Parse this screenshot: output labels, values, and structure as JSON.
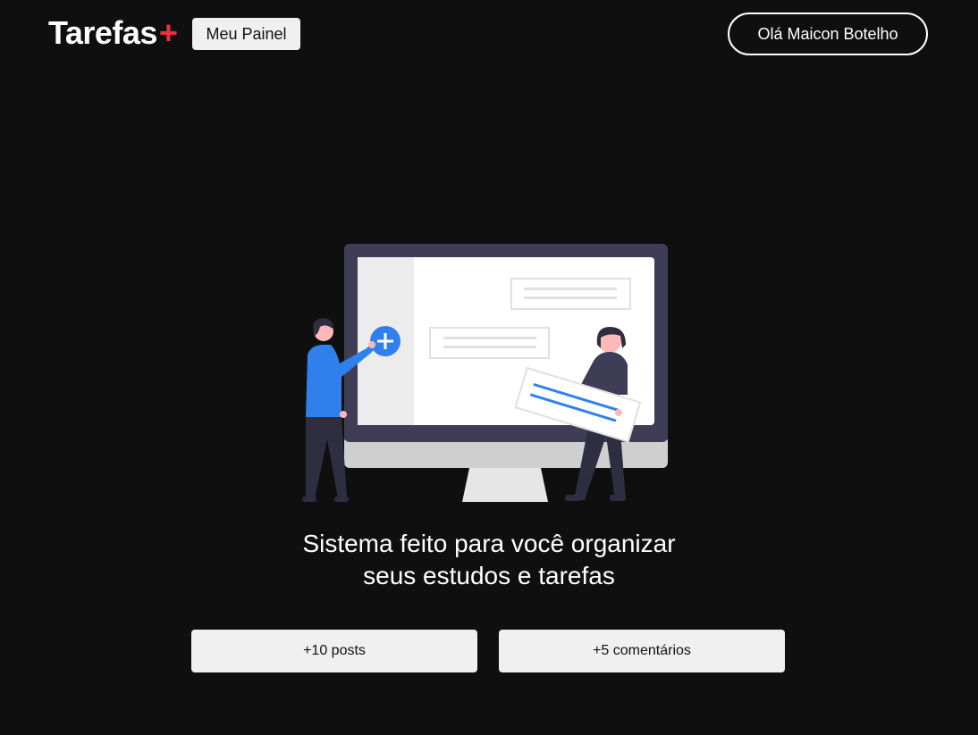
{
  "header": {
    "logo_text": "Tarefas",
    "logo_plus": "+",
    "panel_button_label": "Meu Painel",
    "user_button_label": "Olá Maicon Botelho"
  },
  "hero": {
    "illustration_icon": "task-board-illustration",
    "title_line1": "Sistema feito para você organizar",
    "title_line2": "seus estudos e tarefas"
  },
  "stats": {
    "posts_label": "+10 posts",
    "comments_label": "+5 comentários"
  },
  "colors": {
    "background": "#0f0f0f",
    "accent": "#ea3140",
    "button_bg": "#f0f0f0",
    "illustration_blue": "#2f80ed",
    "illustration_dark": "#3f3d56"
  }
}
